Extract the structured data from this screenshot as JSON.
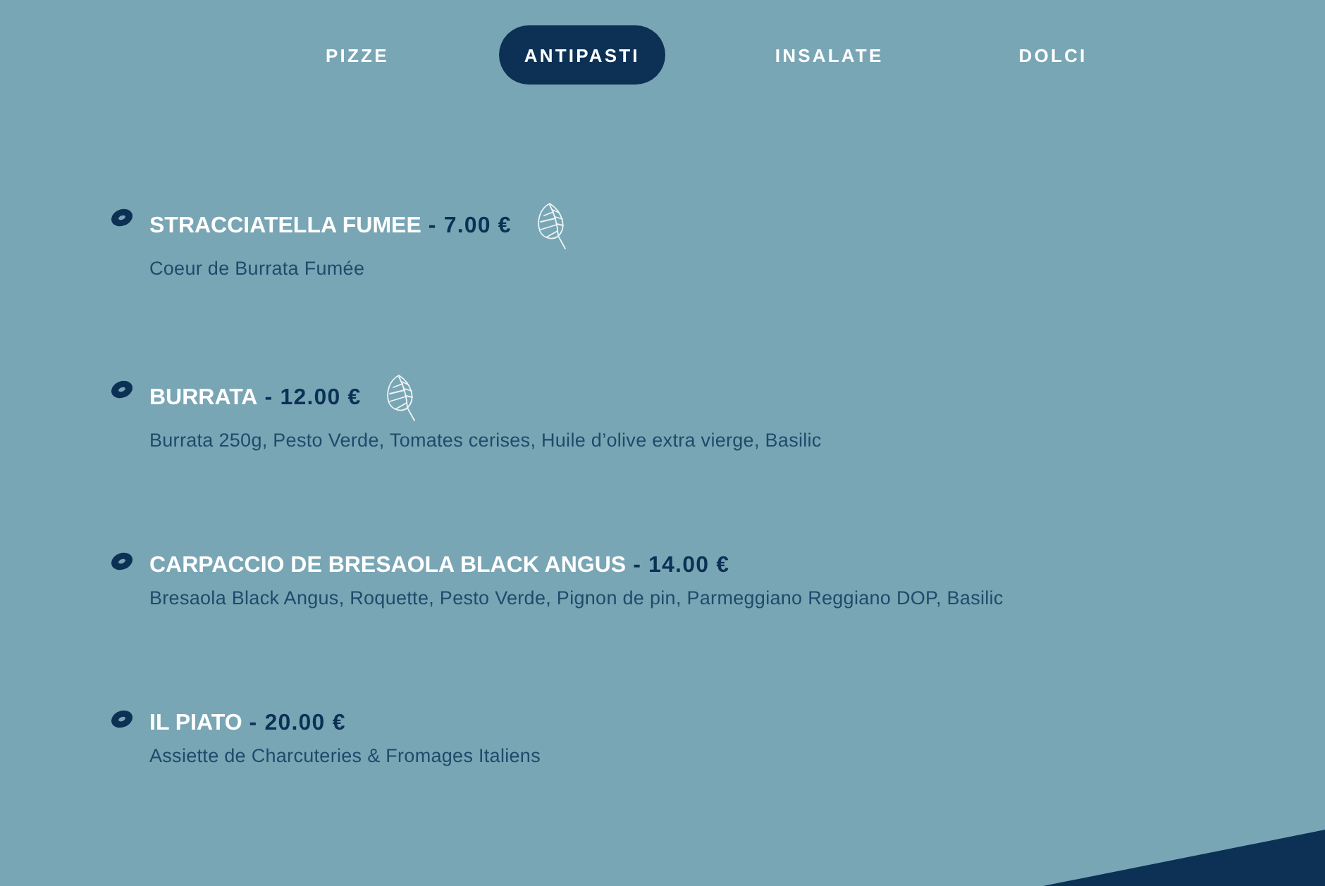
{
  "tabs": [
    {
      "label": "PIZZE",
      "selected": false
    },
    {
      "label": "ANTIPASTI",
      "selected": true
    },
    {
      "label": "INSALATE",
      "selected": false
    },
    {
      "label": "DOLCI",
      "selected": false
    }
  ],
  "items": [
    {
      "name": "STRACCIATELLA FUMEE",
      "price": "- 7.00 €",
      "leaf": true,
      "description": "Coeur de Burrata Fumée"
    },
    {
      "name": "BURRATA",
      "price": "- 12.00 €",
      "leaf": true,
      "description": "Burrata 250g, Pesto Verde, Tomates cerises, Huile d’olive extra vierge, Basilic"
    },
    {
      "name": "CARPACCIO DE BRESAOLA BLACK ANGUS",
      "price": "- 14.00 €",
      "leaf": false,
      "description": "Bresaola Black Angus, Roquette, Pesto Verde, Pignon de pin, Parmeggiano Reggiano DOP, Basilic"
    },
    {
      "name": "IL PIATO",
      "price": "- 20.00 €",
      "leaf": false,
      "description": "Assiette de Charcuteries & Fromages Italiens"
    }
  ]
}
